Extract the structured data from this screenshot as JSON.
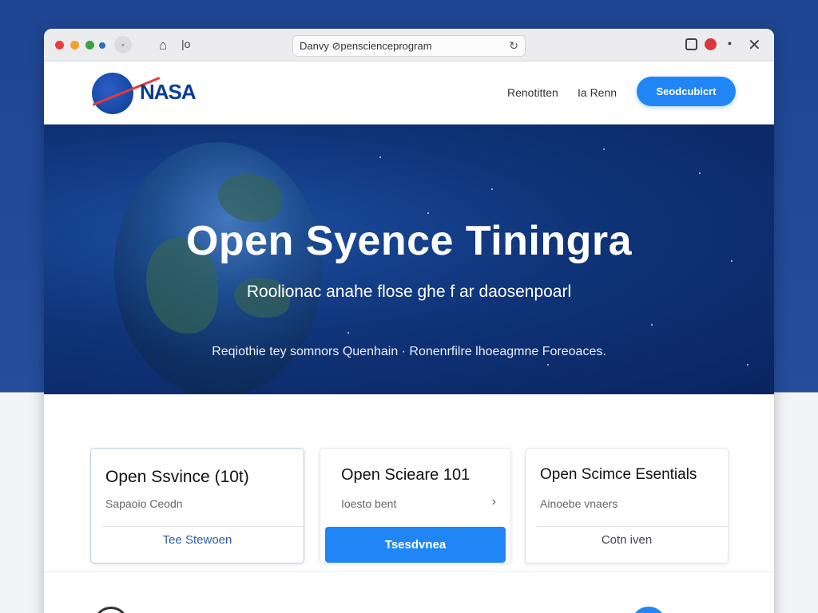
{
  "browser": {
    "url": "Danvy ⊘penscienceprogram",
    "nav_home_icon": "home-icon",
    "tab_separator": "|o"
  },
  "header": {
    "logo_text": "NASA",
    "nav_links": [
      "Renotitten",
      "Ia Renn"
    ],
    "cta_label": "Seodcubicrt"
  },
  "hero": {
    "title": "Open Syence Tiningra",
    "subtitle": "Roolionac anahe flose ghe f ar daosenpoarl",
    "tagline": "Reqiothie tey somnors Quenhain  ·  Ronenrfilre lhoeagmne Foreoaces."
  },
  "cards": [
    {
      "title": "Open Ssvince (10t)",
      "subtitle": "Sapaoio Ceodn",
      "action": "Tee Stewoen",
      "style": "outline"
    },
    {
      "title": "Open Scieare 101",
      "subtitle": "Ioesto bent",
      "action": "Tsesdvnea",
      "style": "primary"
    },
    {
      "title": "Open Scimce Esentials",
      "subtitle": "Ainoebe vnaers",
      "action": "Cotn iven",
      "style": "outline"
    }
  ],
  "colors": {
    "accent": "#2186f5",
    "nasa_blue": "#0b3d91",
    "nasa_red": "#e03a3e",
    "background": "#1e4591"
  }
}
